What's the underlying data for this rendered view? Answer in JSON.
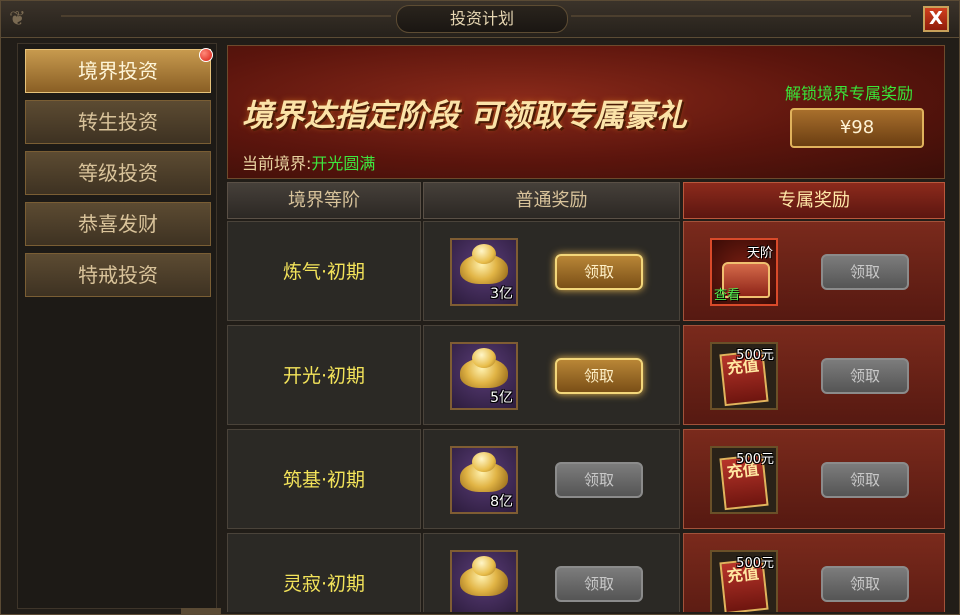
{
  "window": {
    "title": "投资计划",
    "close_label": "X"
  },
  "sidebar": {
    "items": [
      {
        "label": "境界投资",
        "active": true,
        "has_notification": true
      },
      {
        "label": "转生投资",
        "active": false
      },
      {
        "label": "等级投资",
        "active": false
      },
      {
        "label": "恭喜发财",
        "active": false
      },
      {
        "label": "特戒投资",
        "active": false
      }
    ]
  },
  "banner": {
    "headline": "境界达指定阶段 可领取专属豪礼",
    "current_realm_label": "当前境界:",
    "current_realm_value": "开光圆满",
    "unlock_label": "解锁境界专属奖励",
    "price": "¥98"
  },
  "table": {
    "headers": {
      "realm": "境界等阶",
      "normal": "普通奖励",
      "exclusive": "专属奖励"
    },
    "rows": [
      {
        "realm": "炼气·初期",
        "normal_qty": "3亿",
        "normal_claim": "领取",
        "normal_claimable": true,
        "exclusive_type": "chest",
        "exclusive_tag": "天阶",
        "exclusive_view": "查看",
        "exclusive_claim": "领取"
      },
      {
        "realm": "开光·初期",
        "normal_qty": "5亿",
        "normal_claim": "领取",
        "normal_claimable": true,
        "exclusive_type": "card",
        "exclusive_amount": "500元",
        "exclusive_card_text": "充值",
        "exclusive_claim": "领取"
      },
      {
        "realm": "筑基·初期",
        "normal_qty": "8亿",
        "normal_claim": "领取",
        "normal_claimable": false,
        "exclusive_type": "card",
        "exclusive_amount": "500元",
        "exclusive_card_text": "充值",
        "exclusive_claim": "领取"
      },
      {
        "realm": "灵寂·初期",
        "normal_qty": "",
        "normal_claim": "领取",
        "normal_claimable": false,
        "exclusive_type": "card",
        "exclusive_amount": "500元",
        "exclusive_card_text": "充值",
        "exclusive_claim": "领取"
      }
    ]
  },
  "colors": {
    "realm_text": "#f3e35a",
    "green_text": "#3ee63e",
    "exclusive_bg": "#7a2a1c",
    "active_tab": "#c79a4e"
  }
}
